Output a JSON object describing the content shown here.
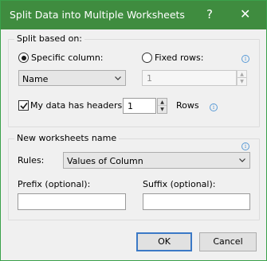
{
  "window": {
    "title": "Split Data into Multiple Worksheets",
    "help_glyph": "?",
    "close_glyph": "✕"
  },
  "split": {
    "group_title": "Split based on:",
    "specific_column_label": "Specific column:",
    "specific_column_selected": true,
    "fixed_rows_label": "Fixed rows:",
    "fixed_rows_selected": false,
    "column_value": "Name",
    "fixed_rows_value": "1",
    "headers_label": "My data has headers",
    "headers_checked": true,
    "headers_value": "1",
    "rows_label": "Rows"
  },
  "worksheets": {
    "group_title": "New worksheets name",
    "rules_label": "Rules:",
    "rules_value": "Values of Column",
    "prefix_label": "Prefix (optional):",
    "prefix_value": "",
    "suffix_label": "Suffix (optional):",
    "suffix_value": ""
  },
  "footer": {
    "ok_label": "OK",
    "cancel_label": "Cancel"
  },
  "icons": {
    "info": "info-icon",
    "chevron": "chevron-down-icon",
    "spin_up": "▲",
    "spin_down": "▼"
  },
  "colors": {
    "title_bar": "#3f8c3f",
    "accent_focus": "#3b79c6",
    "info": "#5a9bd6"
  }
}
